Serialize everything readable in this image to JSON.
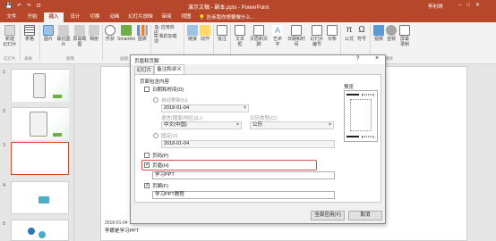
{
  "window": {
    "title": "演示文稿 - 副本.pptx - PowerPoint",
    "user": "李利琪",
    "qat": [
      "💾",
      "↶",
      "↷",
      "⊡"
    ]
  },
  "tabs": [
    "文件",
    "开始",
    "插入",
    "设计",
    "切换",
    "动画",
    "幻灯片放映",
    "审阅",
    "视图"
  ],
  "tell_me": "告诉我你想要做什么...",
  "ribbon": {
    "buttons": [
      {
        "label": "新建\n幻灯片",
        "icon": "new-slide"
      },
      {
        "label": "表格",
        "icon": "table"
      },
      {
        "label": "图片",
        "icon": "picture"
      },
      {
        "label": "联机图片",
        "icon": "online-picture"
      },
      {
        "label": "屏幕截图",
        "icon": "screenshot"
      },
      {
        "label": "相册",
        "icon": "album"
      },
      {
        "label": "形状",
        "icon": "shapes"
      },
      {
        "label": "SmartArt",
        "icon": "smartart"
      },
      {
        "label": "图表",
        "icon": "chart"
      },
      {
        "label": "应用商店",
        "icon": "store"
      },
      {
        "label": "我的加载项",
        "icon": "addins"
      },
      {
        "label": "链接",
        "icon": "link"
      },
      {
        "label": "动作",
        "icon": "action"
      },
      {
        "label": "批注",
        "icon": "comment"
      },
      {
        "label": "文本框",
        "icon": "textbox"
      },
      {
        "label": "页眉和页脚",
        "icon": "header-footer"
      },
      {
        "label": "艺术字",
        "icon": "wordart"
      },
      {
        "label": "日期和时间",
        "icon": "datetime"
      },
      {
        "label": "幻灯片\n编号",
        "icon": "slide-number"
      },
      {
        "label": "对象",
        "icon": "object"
      },
      {
        "label": "公式",
        "icon": "equation"
      },
      {
        "label": "符号",
        "icon": "symbol"
      },
      {
        "label": "视频",
        "icon": "video"
      },
      {
        "label": "音频",
        "icon": "audio"
      },
      {
        "label": "屏幕\n录制",
        "icon": "screen-record"
      }
    ],
    "groups": [
      "幻灯片",
      "表格",
      "图像",
      "插图",
      "加载项",
      "链接",
      "批注",
      "文本",
      "符号",
      "媒体"
    ]
  },
  "slides": [
    {
      "num": "1"
    },
    {
      "num": "2"
    },
    {
      "num": "3"
    },
    {
      "num": "4"
    },
    {
      "num": "5"
    }
  ],
  "slide_footer": {
    "date": "2018-01-04",
    "text": "李娜是学习PPT"
  },
  "dialog": {
    "title": "页眉和页脚",
    "tabs": [
      "幻灯片",
      "备注和讲义"
    ],
    "section": "页面包含内容",
    "datetime": {
      "label": "日期和时间(D)",
      "checked": false
    },
    "auto_update": {
      "label": "自动更新(U)",
      "value": "2018-01-04"
    },
    "language": {
      "label": "语言(国家/地区)(L):",
      "value": "中文(中国)"
    },
    "calendar": {
      "label": "日历类型(C):",
      "value": "公历"
    },
    "fixed": {
      "label": "固定(X)",
      "value": "2018-01-04"
    },
    "page_number": {
      "label": "页码(P)",
      "checked": false
    },
    "header": {
      "label": "页眉(H)",
      "checked": true,
      "value": "学习PPT"
    },
    "footer": {
      "label": "页脚(F)",
      "checked": true,
      "value": "学习PPT教程"
    },
    "preview_label": "预览",
    "apply_all": "全部应用(Y)",
    "cancel": "取消",
    "help": "?",
    "close": "×"
  }
}
